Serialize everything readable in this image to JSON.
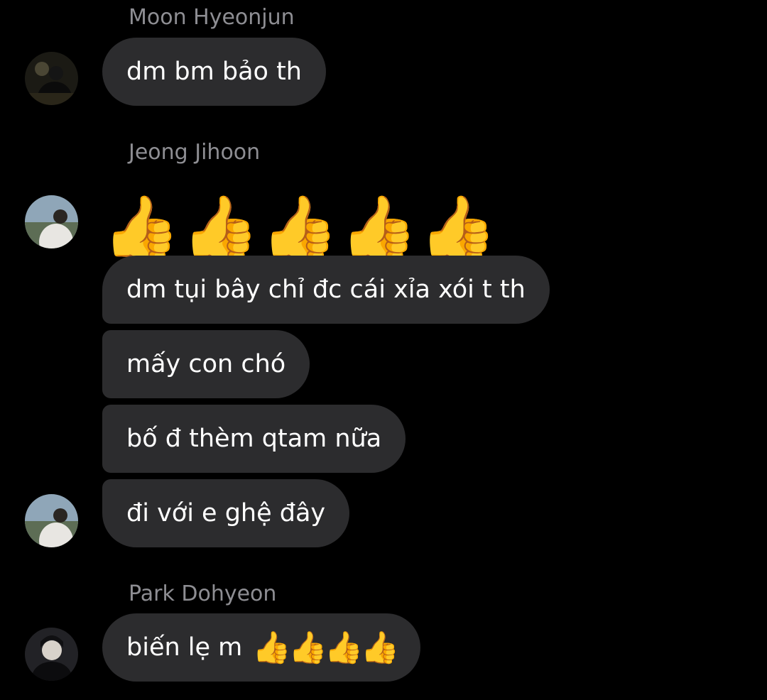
{
  "messages": [
    {
      "sender": "Moon Hyeonjun",
      "avatar": "moon-hyeonjun-avatar",
      "texts": [
        "dm bm bảo th"
      ]
    },
    {
      "sender": "Jeong Jihoon",
      "avatar": "jeong-jihoon-avatar",
      "emoji": "👍👍👍👍👍",
      "texts": [
        "dm tụi bây chỉ đc cái xỉa xói t th",
        "mấy con chó",
        "bố đ thèm qtam nữa",
        "đi với e ghệ đây"
      ]
    },
    {
      "sender": "Park Dohyeon",
      "avatar": "park-dohyeon-avatar",
      "texts": [
        "biến lẹ m"
      ],
      "inline_emoji": "👍👍👍👍"
    }
  ],
  "colors": {
    "background": "#000000",
    "bubble": "#2c2c2e",
    "text": "#ffffff",
    "sender_name": "#8e8e93"
  }
}
